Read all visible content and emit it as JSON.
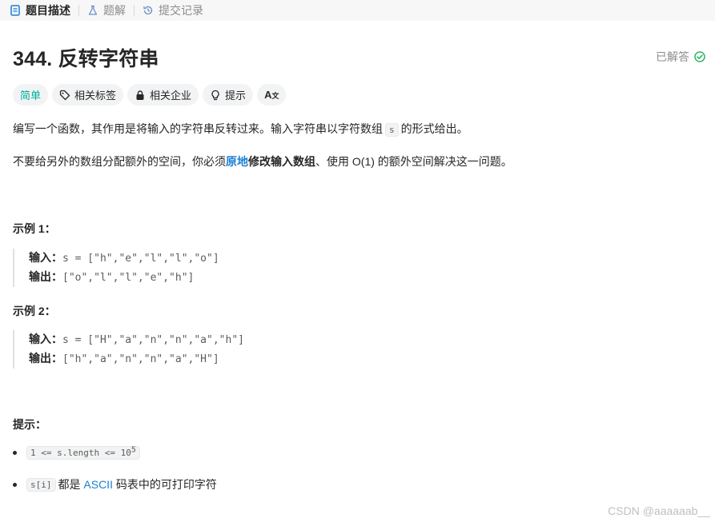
{
  "tabs": [
    {
      "label": "题目描述",
      "icon": "document-icon",
      "active": true
    },
    {
      "label": "题解",
      "icon": "flask-icon",
      "active": false
    },
    {
      "label": "提交记录",
      "icon": "history-icon",
      "active": false
    }
  ],
  "problem": {
    "title": "344. 反转字符串",
    "status": "已解答",
    "tags": {
      "difficulty": "简单",
      "related_tags": "相关标签",
      "related_companies": "相关企业",
      "hint": "提示",
      "font_toggle": "A"
    },
    "desc1_before": "编写一个函数，其作用是将输入的字符串反转过来。输入字符串以字符数组",
    "desc1_code": "s",
    "desc1_after": "的形式给出。",
    "desc2_part1": "不要给另外的数组分配额外的空间，你必须",
    "desc2_link": "原地",
    "desc2_bold": "修改输入数组",
    "desc2_part2": "、使用 O(1) 的额外空间解决这一问题。"
  },
  "examples": [
    {
      "heading": "示例 1：",
      "input_label": "输入：",
      "input_value": "s = [\"h\",\"e\",\"l\",\"l\",\"o\"]",
      "output_label": "输出：",
      "output_value": "[\"o\",\"l\",\"l\",\"e\",\"h\"]"
    },
    {
      "heading": "示例 2：",
      "input_label": "输入：",
      "input_value": "s = [\"H\",\"a\",\"n\",\"n\",\"a\",\"h\"]",
      "output_label": "输出：",
      "output_value": "[\"h\",\"a\",\"n\",\"n\",\"a\",\"H\"]"
    }
  ],
  "constraints": {
    "heading": "提示：",
    "c1_code": "1 <= s.length <= 10",
    "c1_exp": "5",
    "c2_code": "s[i]",
    "c2_text1": "都是",
    "c2_link": "ASCII",
    "c2_text2": "码表中的可打印字符"
  },
  "watermark": "CSDN @aaaaaab__",
  "colors": {
    "easy": "#00af9b",
    "link": "#1a7fd4",
    "solved_check": "#2db55d"
  }
}
